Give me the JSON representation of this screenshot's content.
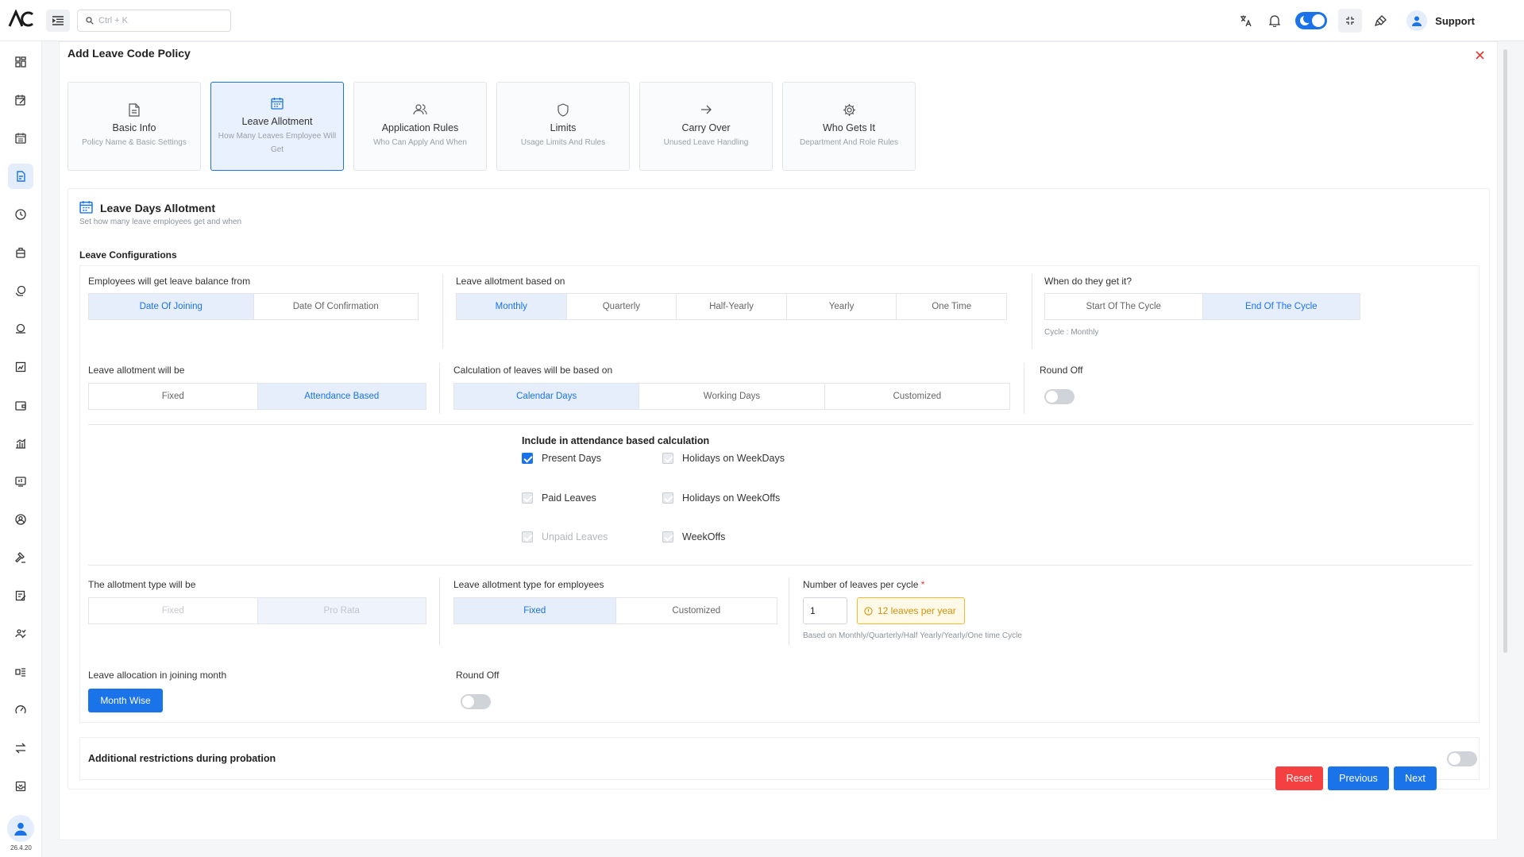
{
  "app": {
    "logo_text": "AC",
    "version": "26.4.20"
  },
  "search": {
    "placeholder": "Ctrl + K"
  },
  "header": {
    "support_label": "Support"
  },
  "page": {
    "title": "Add Leave Code Policy"
  },
  "steps": [
    {
      "title": "Basic Info",
      "subtitle": "Policy Name & Basic Settings",
      "icon": "document-icon",
      "active": false
    },
    {
      "title": "Leave Allotment",
      "subtitle": "How Many Leaves Employee Will Get",
      "icon": "calendar-icon",
      "active": true
    },
    {
      "title": "Application Rules",
      "subtitle": "Who Can Apply And When",
      "icon": "users-icon",
      "active": false
    },
    {
      "title": "Limits",
      "subtitle": "Usage Limits And Rules",
      "icon": "shield-icon",
      "active": false
    },
    {
      "title": "Carry Over",
      "subtitle": "Unused Leave Handling",
      "icon": "arrow-right-icon",
      "active": false
    },
    {
      "title": "Who Gets It",
      "subtitle": "Department And Role Rules",
      "icon": "gear-icon",
      "active": false
    }
  ],
  "section": {
    "title": "Leave Days Allotment",
    "subtitle": "Set how many leave employees get and when",
    "config_label": "Leave Configurations"
  },
  "balance_from": {
    "label": "Employees will get leave balance from",
    "options": [
      "Date Of Joining",
      "Date Of Confirmation"
    ],
    "selected": "Date Of Joining"
  },
  "allotment_based_on": {
    "label": "Leave allotment based on",
    "options": [
      "Monthly",
      "Quarterly",
      "Half-Yearly",
      "Yearly",
      "One Time"
    ],
    "selected": "Monthly"
  },
  "when_get": {
    "label": "When do they get it?",
    "options": [
      "Start Of The Cycle",
      "End Of The Cycle"
    ],
    "selected": "End Of The Cycle",
    "hint": "Cycle : Monthly"
  },
  "allotment_will_be": {
    "label": "Leave allotment will be",
    "options": [
      "Fixed",
      "Attendance Based"
    ],
    "selected": "Attendance Based"
  },
  "calculation_based_on": {
    "label": "Calculation of leaves will be based on",
    "options": [
      "Calendar Days",
      "Working Days",
      "Customized"
    ],
    "selected": "Calendar Days"
  },
  "round_off_1": {
    "label": "Round Off",
    "on": false
  },
  "include": {
    "title": "Include in attendance based calculation",
    "items": [
      {
        "label": "Present Days",
        "checked": true,
        "disabled": false
      },
      {
        "label": "Holidays on WeekDays",
        "checked": true,
        "disabled": true
      },
      {
        "label": "Paid Leaves",
        "checked": true,
        "disabled": true
      },
      {
        "label": "Holidays on WeekOffs",
        "checked": true,
        "disabled": true
      },
      {
        "label": "Unpaid Leaves",
        "checked": true,
        "disabled": true
      },
      {
        "label": "WeekOffs",
        "checked": true,
        "disabled": true
      }
    ]
  },
  "allotment_type": {
    "label": "The allotment type will be",
    "options": [
      "Fixed",
      "Pro Rata"
    ],
    "selected": "Pro Rata"
  },
  "allotment_type_employees": {
    "label": "Leave allotment type for employees",
    "options": [
      "Fixed",
      "Customized"
    ],
    "selected": "Fixed"
  },
  "leaves_per_cycle": {
    "label": "Number of leaves per cycle",
    "required_mark": "*",
    "value": "1",
    "badge": "12 leaves per year",
    "hint": "Based on Monthly/Quarterly/Half Yearly/Yearly/One time Cycle"
  },
  "joining_month": {
    "label": "Leave allocation in joining month",
    "button": "Month Wise"
  },
  "round_off_2": {
    "label": "Round Off",
    "on": false
  },
  "probation": {
    "label": "Additional restrictions during probation",
    "on": false
  },
  "footer": {
    "reset": "Reset",
    "previous": "Previous",
    "next": "Next"
  },
  "colors": {
    "accent": "#1a73e8",
    "danger": "#f44040",
    "warning": "#f5b82e"
  }
}
